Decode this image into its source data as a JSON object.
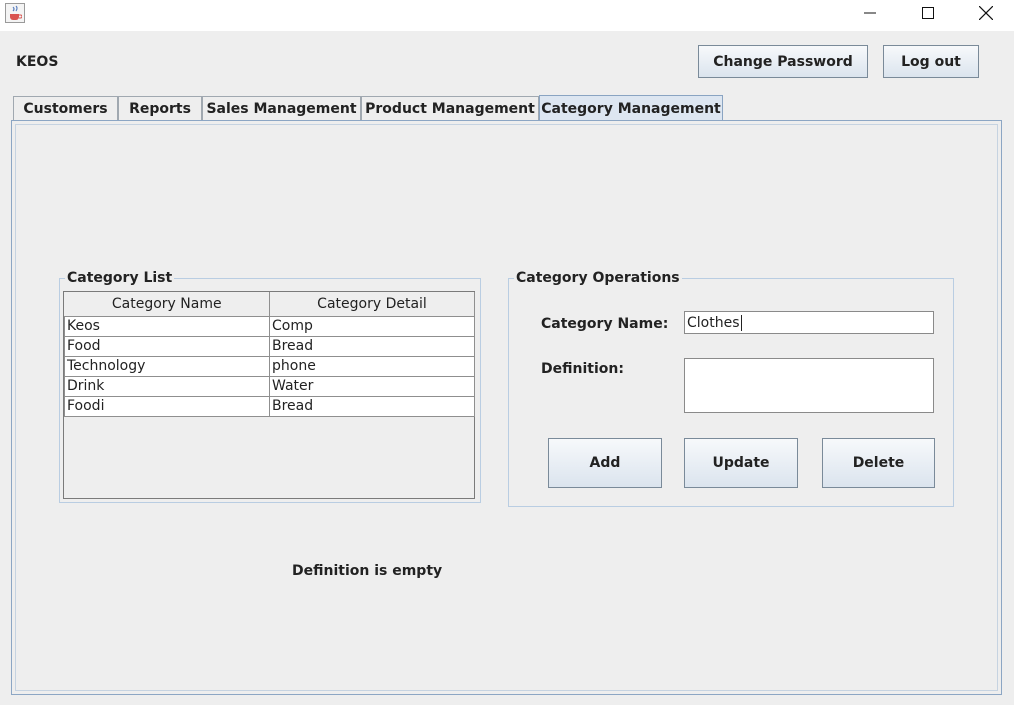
{
  "window": {
    "icon": "java-app-icon",
    "controls": {
      "minimize": "minimize-icon",
      "maximize": "maximize-icon",
      "close": "close-icon"
    }
  },
  "header": {
    "app_name": "KEOS",
    "change_password_label": "Change Password",
    "logout_label": "Log out"
  },
  "tabs": [
    {
      "label": "Customers",
      "active": false
    },
    {
      "label": "Reports",
      "active": false
    },
    {
      "label": "Sales Management",
      "active": false
    },
    {
      "label": "Product Management",
      "active": false
    },
    {
      "label": "Category Management",
      "active": true
    }
  ],
  "category_list": {
    "title": "Category List",
    "columns": [
      "Category Name",
      "Category Detail"
    ],
    "rows": [
      [
        "Keos",
        "Comp"
      ],
      [
        "Food",
        "Bread"
      ],
      [
        "Technology",
        "phone"
      ],
      [
        "Drink",
        "Water"
      ],
      [
        "Foodi",
        "Bread"
      ]
    ]
  },
  "category_operations": {
    "title": "Category Operations",
    "name_label": "Category Name:",
    "name_value": "Clothes",
    "definition_label": "Definition:",
    "definition_value": "",
    "add_label": "Add",
    "update_label": "Update",
    "delete_label": "Delete"
  },
  "status_message": "Definition is empty",
  "colors": {
    "active_tab": "#dde6f1",
    "panel_border": "#8ca6c4",
    "background": "#eeeeee"
  }
}
